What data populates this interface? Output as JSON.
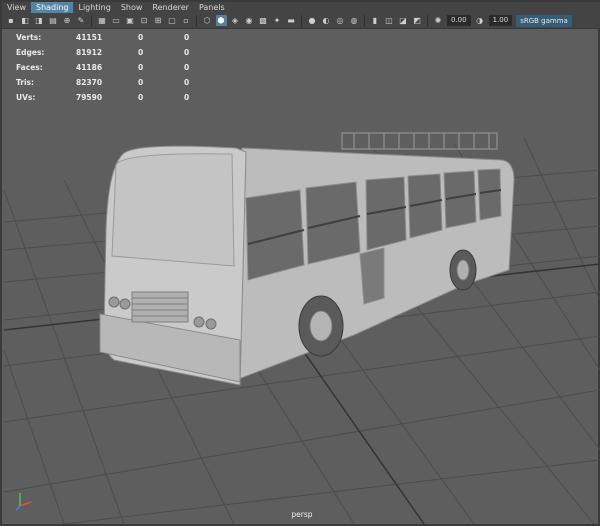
{
  "menubar": {
    "items": [
      "View",
      "Shading",
      "Lighting",
      "Show",
      "Renderer",
      "Panels"
    ],
    "active": "Shading"
  },
  "toolbar": {
    "exposure_value": "0.00",
    "gamma_value": "1.00",
    "color_space": "sRGB gamma"
  },
  "stats": {
    "rows": [
      {
        "name": "Verts:",
        "v1": "41151",
        "v2": "0",
        "v3": "0"
      },
      {
        "name": "Edges:",
        "v1": "81912",
        "v2": "0",
        "v3": "0"
      },
      {
        "name": "Faces:",
        "v1": "41186",
        "v2": "0",
        "v3": "0"
      },
      {
        "name": "Tris:",
        "v1": "82370",
        "v2": "0",
        "v3": "0"
      },
      {
        "name": "UVs:",
        "v1": "79590",
        "v2": "0",
        "v3": "0"
      }
    ]
  },
  "camera": "persp",
  "colors": {
    "viewport_bg": "#5e5e5e",
    "active_menu": "#5285a6",
    "grid": "#4a4a4a",
    "model": "#c8c8c8"
  }
}
